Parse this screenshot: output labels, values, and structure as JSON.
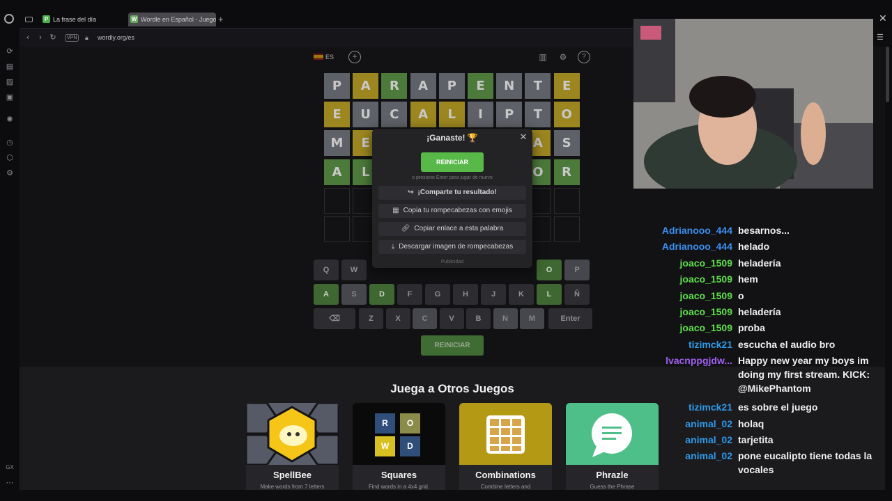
{
  "browser": {
    "tabs": [
      {
        "label": "La frase del día",
        "favicon": "P",
        "color": "#4caf50"
      },
      {
        "label": "Wordle en Español - Juego",
        "favicon": "W",
        "color": "#6aaa64"
      }
    ],
    "vpn": "VPN",
    "url": "wordly.org/es"
  },
  "game": {
    "language": "ES",
    "board": [
      [
        [
          "P",
          "x"
        ],
        [
          "A",
          "y"
        ],
        [
          "R",
          "g"
        ],
        [
          "A",
          "x"
        ],
        [
          "P",
          "x"
        ],
        [
          "E",
          "g"
        ],
        [
          "N",
          "x"
        ],
        [
          "T",
          "x"
        ],
        [
          "E",
          "y"
        ]
      ],
      [
        [
          "E",
          "y"
        ],
        [
          "U",
          "x"
        ],
        [
          "C",
          "x"
        ],
        [
          "A",
          "y"
        ],
        [
          "L",
          "y"
        ],
        [
          "I",
          "x"
        ],
        [
          "P",
          "x"
        ],
        [
          "T",
          "x"
        ],
        [
          "O",
          "y"
        ]
      ],
      [
        [
          "M",
          "x"
        ],
        [
          "E",
          "y"
        ],
        [
          "",
          ""
        ],
        [
          "",
          ""
        ],
        [
          "",
          ""
        ],
        [
          "",
          ""
        ],
        [
          "",
          ""
        ],
        [
          "A",
          "y"
        ],
        [
          "S",
          "x"
        ]
      ],
      [
        [
          "A",
          "g"
        ],
        [
          "L",
          "g"
        ],
        [
          "",
          ""
        ],
        [
          "",
          ""
        ],
        [
          "",
          ""
        ],
        [
          "",
          ""
        ],
        [
          "",
          ""
        ],
        [
          "O",
          "g"
        ],
        [
          "R",
          "g"
        ]
      ],
      [
        [
          "",
          "e"
        ],
        [
          "",
          "e"
        ],
        [
          "",
          ""
        ],
        [
          "",
          ""
        ],
        [
          "",
          ""
        ],
        [
          "",
          ""
        ],
        [
          "",
          ""
        ],
        [
          "",
          "e"
        ],
        [
          "",
          "e"
        ]
      ],
      [
        [
          "",
          "e"
        ],
        [
          "",
          "e"
        ],
        [
          "",
          ""
        ],
        [
          "",
          ""
        ],
        [
          "",
          ""
        ],
        [
          "",
          ""
        ],
        [
          "",
          ""
        ],
        [
          "",
          "e"
        ],
        [
          "",
          "e"
        ]
      ]
    ],
    "keyboard": {
      "row1": [
        [
          "Q",
          ""
        ],
        [
          "W",
          ""
        ],
        [
          "O",
          "g"
        ],
        [
          "P",
          "x"
        ]
      ],
      "row2": [
        [
          "A",
          "g"
        ],
        [
          "S",
          "x"
        ],
        [
          "D",
          "g"
        ],
        [
          "F",
          ""
        ],
        [
          "G",
          ""
        ],
        [
          "H",
          ""
        ],
        [
          "J",
          ""
        ],
        [
          "K",
          ""
        ],
        [
          "L",
          "g"
        ],
        [
          "Ñ",
          ""
        ]
      ],
      "row3": [
        [
          "Z",
          ""
        ],
        [
          "X",
          ""
        ],
        [
          "C",
          "x"
        ],
        [
          "V",
          ""
        ],
        [
          "B",
          ""
        ],
        [
          "N",
          "x"
        ],
        [
          "M",
          "x"
        ]
      ],
      "enter": "Enter"
    },
    "restart_label": "REINICIAR"
  },
  "modal": {
    "title": "¡Ganaste! 🏆",
    "restart": "REINICIAR",
    "hint": "o presione Enter para jugar de nuevo",
    "share": "¡Comparte tu resultado!",
    "copy_emojis": "Copia tu rompecabezas con emojis",
    "copy_link": "Copiar enlace a esta palabra",
    "download": "Descargar imagen de rompecabezas",
    "ad": "Publicidad"
  },
  "other_games": {
    "title": "Juega a Otros Juegos",
    "cards": [
      {
        "name": "SpellBee",
        "desc": "Make words from 7 letters",
        "color": "#5a5f6b"
      },
      {
        "name": "Squares",
        "desc": "Find words in a 4x4 grid.",
        "color": "#111"
      },
      {
        "name": "Combinations",
        "desc": "Combine letters and",
        "color": "#b49a14"
      },
      {
        "name": "Phrazle",
        "desc": "Guess the Phrase",
        "color": "#4fbf8a"
      }
    ],
    "squares_letters": [
      "R",
      "O",
      "W",
      "D"
    ]
  },
  "chat": [
    {
      "user": "Adrianooo_444",
      "color": "#3b8ff0",
      "text": "besarnos..."
    },
    {
      "user": "Adrianooo_444",
      "color": "#3b8ff0",
      "text": "helado"
    },
    {
      "user": "joaco_1509",
      "color": "#5ee04a",
      "text": "heladería"
    },
    {
      "user": "joaco_1509",
      "color": "#5ee04a",
      "text": "hem"
    },
    {
      "user": "joaco_1509",
      "color": "#5ee04a",
      "text": "o"
    },
    {
      "user": "joaco_1509",
      "color": "#5ee04a",
      "text": "heladería"
    },
    {
      "user": "joaco_1509",
      "color": "#5ee04a",
      "text": "proba"
    },
    {
      "user": "tizimck21",
      "color": "#2f9ae8",
      "text": "escucha el audio bro"
    },
    {
      "user": "lvacnppgjdw...",
      "color": "#a05ff0",
      "text": "Happy new year my boys im doing my first stream. KICK: @MikePhantom"
    },
    {
      "user": "tizimck21",
      "color": "#2f9ae8",
      "text": "es sobre el juego"
    },
    {
      "user": "animal_02",
      "color": "#2f9ae8",
      "text": "holaq"
    },
    {
      "user": "animal_02",
      "color": "#2f9ae8",
      "text": "tarjetita"
    },
    {
      "user": "animal_02",
      "color": "#2f9ae8",
      "text": "pone eucalipto tiene todas la vocales"
    }
  ]
}
